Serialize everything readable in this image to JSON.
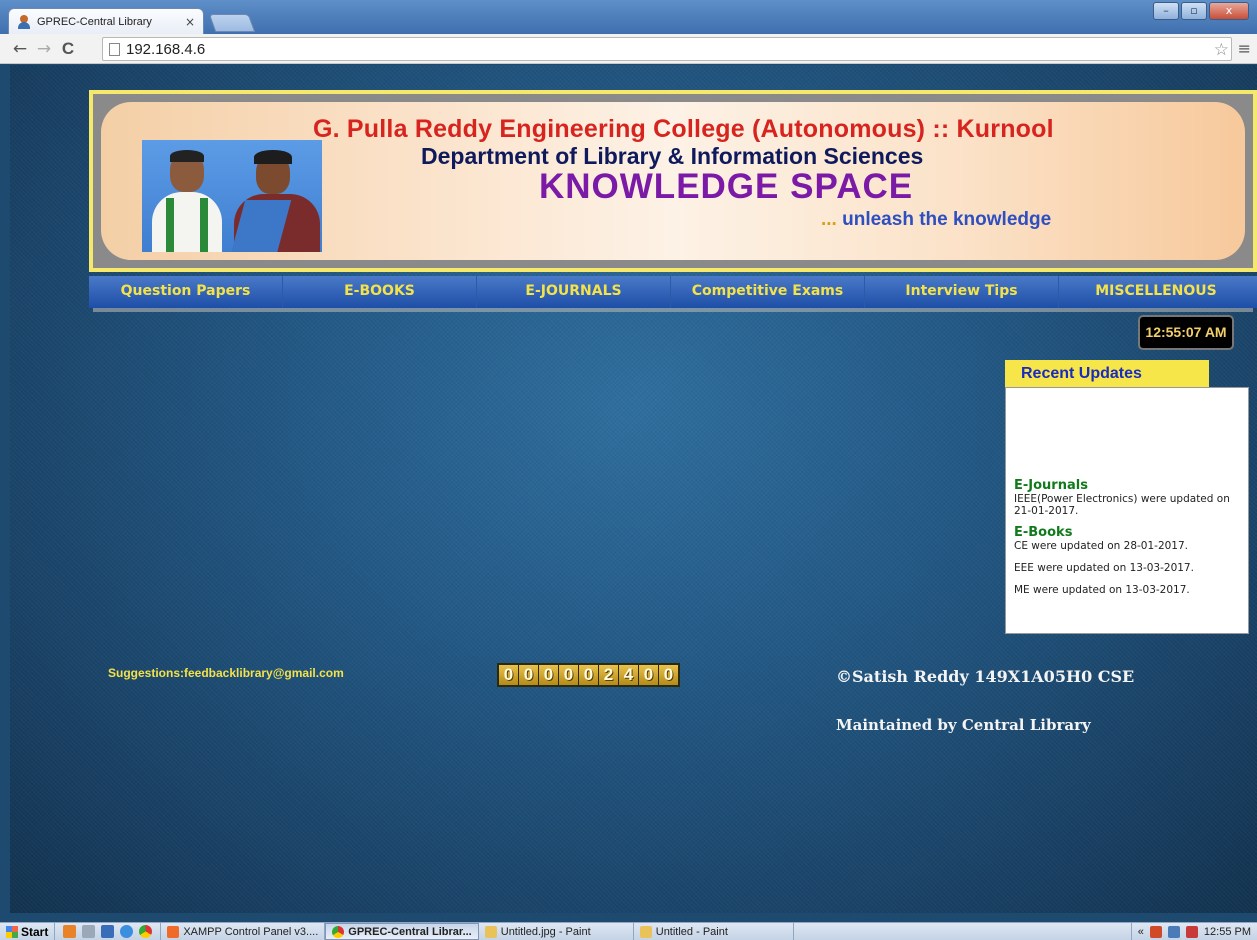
{
  "browser": {
    "tab_title": "GPREC-Central Library",
    "tab_close": "×",
    "url": "192.168.4.6",
    "back": "←",
    "forward": "→",
    "reload": "C",
    "star": "☆",
    "menu": "≡",
    "min": "–",
    "max": "▫",
    "close": "x"
  },
  "banner": {
    "line1": "G. Pulla Reddy Engineering College (Autonomous) :: Kurnool",
    "line2": "Department of Library & Information Sciences",
    "line3": "KNOWLEDGE SPACE",
    "line4_dots": "... ",
    "line4": "unleash the knowledge"
  },
  "nav": {
    "items": [
      {
        "label": "Question Papers"
      },
      {
        "label": "E-BOOKS"
      },
      {
        "label": "E-JOURNALS"
      },
      {
        "label": "Competitive Exams"
      },
      {
        "label": "Interview Tips"
      },
      {
        "label": "MISCELLENOUS"
      }
    ]
  },
  "clock": "12:55:07 AM",
  "updates": {
    "title": "Recent Updates",
    "journals_heading": "E-Journals",
    "journals_text": "IEEE(Power Electronics) were updated on 21-01-2017.",
    "books_heading": "E-Books",
    "books_1": "CE were updated on 28-01-2017.",
    "books_2": "EEE were updated on 13-03-2017.",
    "books_3": "ME were updated on 13-03-2017."
  },
  "footer": {
    "suggestions": "Suggestions:feedbacklibrary@gmail.com",
    "counter_digits": [
      "0",
      "0",
      "0",
      "0",
      "0",
      "2",
      "4",
      "0",
      "0"
    ],
    "credit": "©Satish Reddy 149X1A05H0 CSE",
    "maintained": "Maintained by Central Library"
  },
  "taskbar": {
    "start": "Start",
    "tasks": [
      {
        "label": "XAMPP Control Panel v3...."
      },
      {
        "label": "GPREC-Central Librar..."
      },
      {
        "label": "Untitled.jpg - Paint"
      },
      {
        "label": "Untitled - Paint"
      }
    ],
    "tray_chevron": "«",
    "time": "12:55 PM"
  },
  "colors": {
    "nav_text": "#f3e24a",
    "banner_red": "#d8241e",
    "banner_purple": "#7a1aa6",
    "update_heading": "#117a1c"
  }
}
